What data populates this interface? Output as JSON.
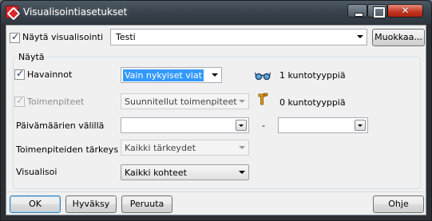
{
  "window": {
    "title": "Visualisointiasetukset",
    "controls": {
      "minimize": "minimize-icon",
      "maximize": "maximize-icon",
      "close": "close-icon"
    }
  },
  "top": {
    "show_vis_label": "Näytä visualisointi",
    "show_vis_checked": true,
    "selected_visualization": "Testi",
    "edit_button": "Muokkaa..."
  },
  "group": {
    "title": "Näytä",
    "observations": {
      "label": "Havainnot",
      "checked": true,
      "value": "Vain nykyiset viat",
      "count_text": "1 kuntotyyppiä",
      "icon": "glasses-icon"
    },
    "measures": {
      "label": "Toimenpiteet",
      "checked": true,
      "disabled": true,
      "value": "Suunnitellut toimenpiteet",
      "count_text": "0 kuntotyyppiä",
      "icon": "wrench-icon"
    },
    "dates": {
      "label": "Päivämäärien välillä",
      "separator": "-",
      "from": "",
      "to": ""
    },
    "priority": {
      "label": "Toimenpiteiden tärkeys",
      "value": "Kaikki tärkeydet"
    },
    "visualize": {
      "label": "Visualisoi",
      "value": "Kaikki kohteet"
    }
  },
  "footer": {
    "ok": "OK",
    "accept": "Hyväksy",
    "cancel": "Peruuta",
    "help": "Ohje"
  }
}
